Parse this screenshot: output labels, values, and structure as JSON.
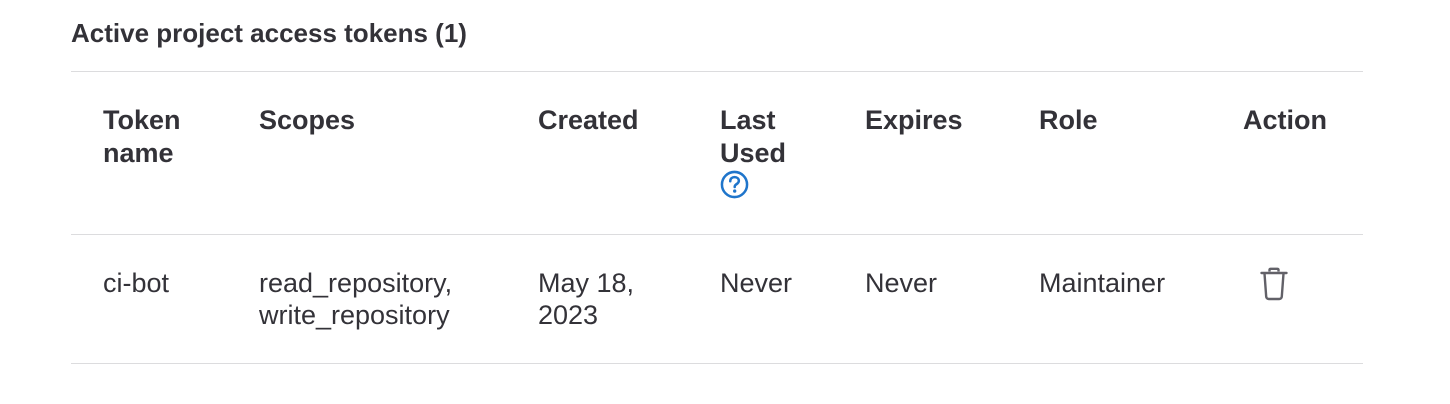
{
  "section": {
    "title": "Active project access tokens (1)"
  },
  "table": {
    "headers": {
      "token_name": [
        "Token",
        "name"
      ],
      "scopes": "Scopes",
      "created": "Created",
      "last_used": [
        "Last",
        "Used"
      ],
      "expires": "Expires",
      "role": "Role",
      "action": "Action"
    },
    "rows": [
      {
        "token_name": "ci-bot",
        "scopes": [
          "read_repository,",
          "write_repository"
        ],
        "created": [
          "May 18,",
          "2023"
        ],
        "last_used": "Never",
        "expires": "Never",
        "role": "Maintainer",
        "action_icon": "trash-icon"
      }
    ]
  },
  "icons": {
    "help": "question-circle-icon",
    "delete": "trash-icon"
  },
  "colors": {
    "text": "#333238",
    "help_icon": "#1f75cb",
    "border": "#dcdcde",
    "trash_icon": "#626168"
  }
}
